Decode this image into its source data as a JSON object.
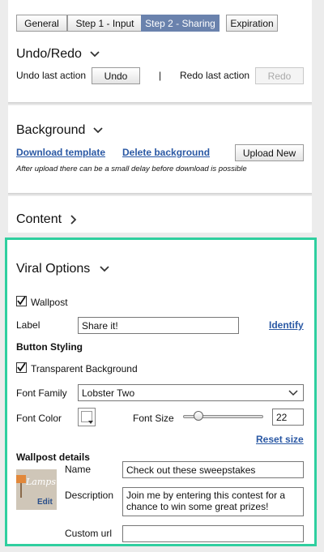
{
  "tabs": {
    "general": "General",
    "step1": "Step 1 - Input",
    "step2": "Step 2 - Sharing",
    "expiration": "Expiration"
  },
  "undo": {
    "heading": "Undo/Redo",
    "undo_label": "Undo last action",
    "undo_button": "Undo",
    "divider": "|",
    "redo_label": "Redo last action",
    "redo_button": "Redo"
  },
  "background": {
    "heading": "Background",
    "download_link": "Download template",
    "delete_link": "Delete background",
    "upload_button": "Upload New",
    "note": "After upload there can be a small delay before download is possible"
  },
  "content": {
    "heading": "Content"
  },
  "viral": {
    "heading": "Viral Options",
    "wallpost_label": "Wallpost",
    "label_label": "Label",
    "label_value": "Share it!",
    "identify_link": "Identify",
    "button_styling": "Button Styling",
    "transparent_label": "Transparent Background",
    "font_family_label": "Font Family",
    "font_family_value": "Lobster Two",
    "font_color_label": "Font Color",
    "font_size_label": "Font Size",
    "font_size_value": "22",
    "reset_size_link": "Reset size",
    "wallpost_details": "Wallpost details",
    "thumb_text": "Lamps",
    "edit_label": "Edit",
    "name_label": "Name",
    "name_value": "Check out these sweepstakes",
    "description_label": "Description",
    "description_value": "Join me by entering this contest for a chance to win some great prizes!",
    "custom_url_label": "Custom url",
    "custom_url_value": ""
  },
  "colors": {
    "accent_border": "#2fcf9f",
    "active_tab": "#6a82ad",
    "link": "#2a58a4"
  }
}
